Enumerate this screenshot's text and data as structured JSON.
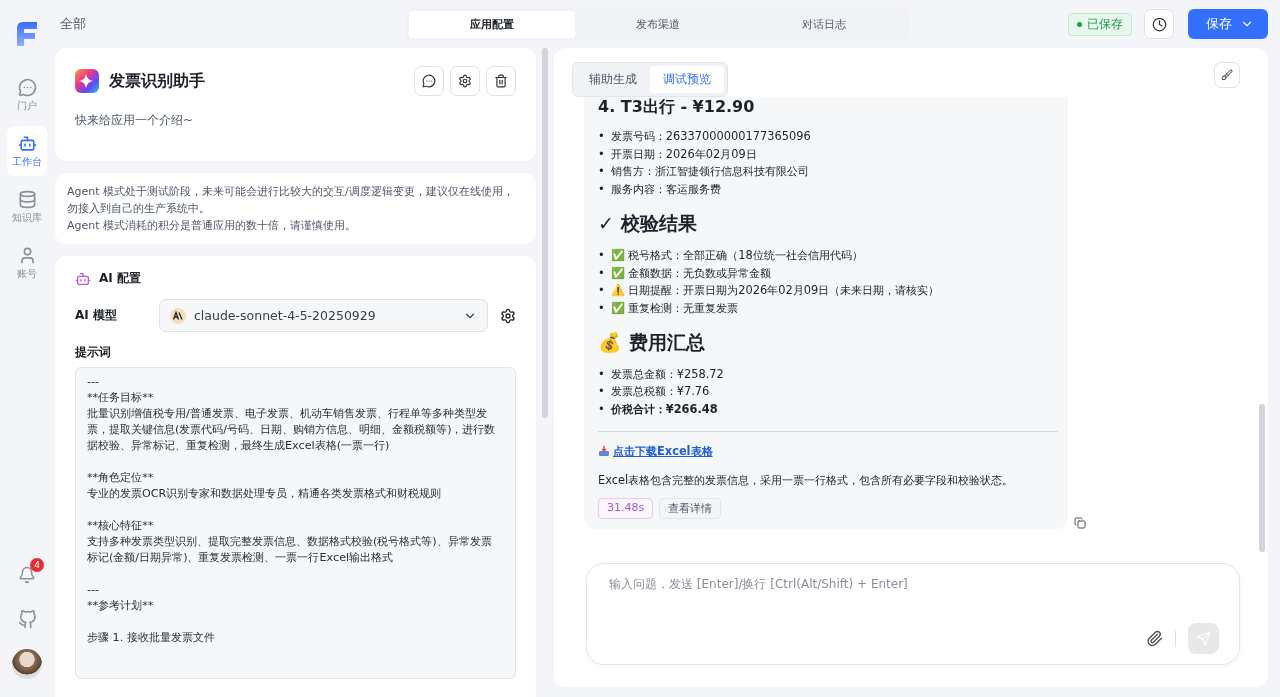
{
  "sidebar": {
    "items": [
      {
        "label": "门户",
        "selected": false
      },
      {
        "label": "工作台",
        "selected": true
      },
      {
        "label": "知识库",
        "selected": false
      },
      {
        "label": "账号",
        "selected": false
      }
    ],
    "notifications": "4"
  },
  "header": {
    "breadcrumb": "全部",
    "tabs": [
      {
        "label": "应用配置",
        "selected": true
      },
      {
        "label": "发布渠道",
        "selected": false
      },
      {
        "label": "对话日志",
        "selected": false
      }
    ],
    "status": "已保存",
    "save_button": "保存"
  },
  "app": {
    "name": "发票识别助手",
    "intro": "快来给应用一个介绍~"
  },
  "notice": [
    "Agent 模式处于测试阶段，未来可能会进行比较大的交互/调度逻辑变更，建议仅在线使用，勿接入到自己的生产系统中。",
    "Agent 模式消耗的积分是普通应用的数十倍，请谨慎使用。"
  ],
  "ai_config": {
    "title": "AI 配置",
    "model_label": "AI 模型",
    "model": "claude-sonnet-4-5-20250929",
    "prompt_label": "提示词",
    "prompt": "---\n**任务目标**\n批量识别增值税专用/普通发票、电子发票、机动车销售发票、行程单等多种类型发票，提取关键信息(发票代码/号码、日期、购销方信息、明细、金额税额等)，进行数据校验、异常标记、重复检测，最终生成Excel表格(一票一行)\n\n**角色定位**\n专业的发票OCR识别专家和数据处理专员，精通各类发票格式和财税规则\n\n**核心特征**\n支持多种发票类型识别、提取完整发票信息、数据格式校验(税号格式等)、异常发票标记(金额/日期异常)、重复发票检测、一票一行Excel输出格式\n\n---\n**参考计划**\n\n步骤 1. 接收批量发票文件"
  },
  "preview": {
    "tabs": [
      {
        "label": "辅助生成",
        "selected": false
      },
      {
        "label": "调试预览",
        "selected": true
      }
    ],
    "message": [
      {
        "kind": "subheading",
        "text": "4. T3出行 - ¥12.90"
      },
      {
        "kind": "list",
        "bullet": "•",
        "items": [
          {
            "text": "发票号码：26337000000177365096",
            "bold": false
          },
          {
            "text": "开票日期：2026年02月09日",
            "bold": false
          },
          {
            "text": "销售方：浙江智捷领行信息科技有限公司",
            "bold": false
          },
          {
            "text": "服务内容：客运服务费",
            "bold": false
          }
        ]
      },
      {
        "kind": "heading",
        "text": "✓ 校验结果"
      },
      {
        "kind": "list",
        "bullet": "•",
        "items": [
          {
            "text": "✅ 税号格式：全部正确（18位统一社会信用代码）",
            "bold": false
          },
          {
            "text": "✅ 金额数据：无负数或异常金额",
            "bold": false
          },
          {
            "text": "⚠️ 日期提醒：开票日期为2026年02月09日（未来日期，请核实）",
            "bold": false
          },
          {
            "text": "✅ 重复检测：无重复发票",
            "bold": false
          }
        ]
      },
      {
        "kind": "heading",
        "text": "💰 费用汇总"
      },
      {
        "kind": "list",
        "bullet": "•",
        "items": [
          {
            "text": "发票总金额：¥258.72",
            "bold": false
          },
          {
            "text": "发票总税额：¥7.76",
            "bold": false
          },
          {
            "text": "价税合计：¥266.48",
            "bold": true
          }
        ]
      },
      {
        "kind": "rule"
      },
      {
        "kind": "link",
        "text": "点击下载Excel表格"
      },
      {
        "kind": "paragraph",
        "text": "Excel表格包含完整的发票信息，采用一票一行格式，包含所有必要字段和校验状态。"
      }
    ],
    "duration": "31.48s",
    "details_button": "查看详情",
    "input_placeholder": "输入问题，发送 [Enter]/换行 [Ctrl(Alt/Shift) + Enter]"
  }
}
